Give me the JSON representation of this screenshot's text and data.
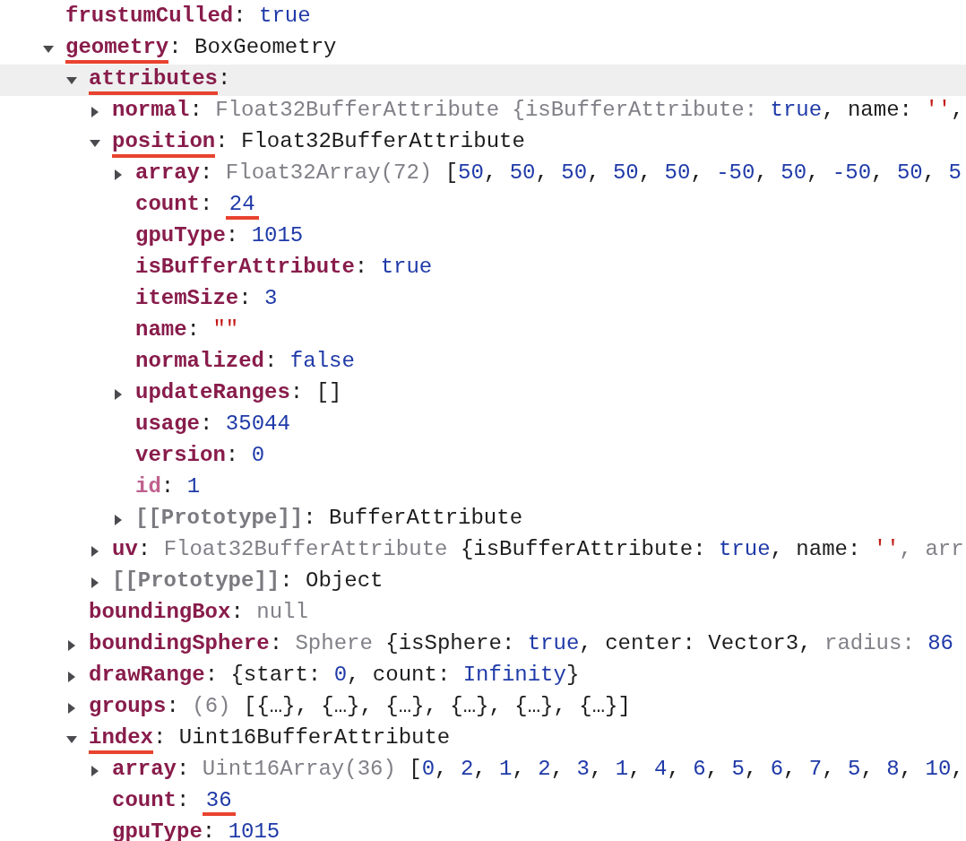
{
  "tree": [
    {
      "key": "frustumCulled",
      "kind": "normal",
      "selected": false,
      "key_underlined": false,
      "value": [
        {
          "text": ": ",
          "kind": "punct"
        },
        {
          "text": "true",
          "kind": "keyword"
        }
      ]
    },
    {
      "key": "geometry",
      "kind": "normal",
      "selected": false,
      "key_underlined": true,
      "expanded": true,
      "value": [
        {
          "text": ": BoxGeometry",
          "kind": "punct"
        }
      ],
      "children": [
        {
          "key": "attributes",
          "kind": "normal",
          "selected": true,
          "key_underlined": true,
          "expanded": true,
          "value": [
            {
              "text": ":",
              "kind": "punct"
            }
          ],
          "children": [
            {
              "key": "normal",
              "kind": "normal",
              "selected": false,
              "key_underlined": false,
              "expanded": false,
              "value": [
                {
                  "text": ": ",
                  "kind": "punct"
                },
                {
                  "text": "Float32BufferAttribute {isBufferAttribute: ",
                  "kind": "dim"
                },
                {
                  "text": "true",
                  "kind": "keyword"
                },
                {
                  "text": ", name: ",
                  "kind": "punct"
                },
                {
                  "text": "''",
                  "kind": "string"
                },
                {
                  "text": ",",
                  "kind": "punct"
                }
              ]
            },
            {
              "key": "position",
              "kind": "normal",
              "selected": false,
              "key_underlined": true,
              "expanded": true,
              "value": [
                {
                  "text": ": Float32BufferAttribute",
                  "kind": "punct"
                }
              ],
              "children": [
                {
                  "key": "array",
                  "kind": "normal",
                  "selected": false,
                  "key_underlined": false,
                  "expanded": false,
                  "value": [
                    {
                      "text": ": ",
                      "kind": "punct"
                    },
                    {
                      "text": "Float32Array(72) ",
                      "kind": "dim"
                    },
                    {
                      "text": "[",
                      "kind": "punct"
                    },
                    {
                      "text": "50",
                      "kind": "number"
                    },
                    {
                      "text": ", ",
                      "kind": "punct"
                    },
                    {
                      "text": "50",
                      "kind": "number"
                    },
                    {
                      "text": ", ",
                      "kind": "punct"
                    },
                    {
                      "text": "50",
                      "kind": "number"
                    },
                    {
                      "text": ", ",
                      "kind": "punct"
                    },
                    {
                      "text": "50",
                      "kind": "number"
                    },
                    {
                      "text": ", ",
                      "kind": "punct"
                    },
                    {
                      "text": "50",
                      "kind": "number"
                    },
                    {
                      "text": ", ",
                      "kind": "punct"
                    },
                    {
                      "text": "-50",
                      "kind": "number"
                    },
                    {
                      "text": ", ",
                      "kind": "punct"
                    },
                    {
                      "text": "50",
                      "kind": "number"
                    },
                    {
                      "text": ", ",
                      "kind": "punct"
                    },
                    {
                      "text": "-50",
                      "kind": "number"
                    },
                    {
                      "text": ", ",
                      "kind": "punct"
                    },
                    {
                      "text": "50",
                      "kind": "number"
                    },
                    {
                      "text": ", ",
                      "kind": "punct"
                    },
                    {
                      "text": "5",
                      "kind": "number"
                    }
                  ]
                },
                {
                  "key": "count",
                  "kind": "normal",
                  "selected": false,
                  "key_underlined": false,
                  "value_underlined": true,
                  "value": [
                    {
                      "text": ": ",
                      "kind": "punct"
                    },
                    {
                      "text": "24",
                      "kind": "number"
                    }
                  ]
                },
                {
                  "key": "gpuType",
                  "kind": "normal",
                  "selected": false,
                  "key_underlined": false,
                  "value": [
                    {
                      "text": ": ",
                      "kind": "punct"
                    },
                    {
                      "text": "1015",
                      "kind": "number"
                    }
                  ]
                },
                {
                  "key": "isBufferAttribute",
                  "kind": "normal",
                  "selected": false,
                  "key_underlined": false,
                  "value": [
                    {
                      "text": ": ",
                      "kind": "punct"
                    },
                    {
                      "text": "true",
                      "kind": "keyword"
                    }
                  ]
                },
                {
                  "key": "itemSize",
                  "kind": "normal",
                  "selected": false,
                  "key_underlined": false,
                  "value": [
                    {
                      "text": ": ",
                      "kind": "punct"
                    },
                    {
                      "text": "3",
                      "kind": "number"
                    }
                  ]
                },
                {
                  "key": "name",
                  "kind": "normal",
                  "selected": false,
                  "key_underlined": false,
                  "value": [
                    {
                      "text": ": ",
                      "kind": "punct"
                    },
                    {
                      "text": "\"\"",
                      "kind": "string"
                    }
                  ]
                },
                {
                  "key": "normalized",
                  "kind": "normal",
                  "selected": false,
                  "key_underlined": false,
                  "value": [
                    {
                      "text": ": ",
                      "kind": "punct"
                    },
                    {
                      "text": "false",
                      "kind": "keyword"
                    }
                  ]
                },
                {
                  "key": "updateRanges",
                  "kind": "normal",
                  "selected": false,
                  "key_underlined": false,
                  "expanded": false,
                  "value": [
                    {
                      "text": ": []",
                      "kind": "punct"
                    }
                  ]
                },
                {
                  "key": "usage",
                  "kind": "normal",
                  "selected": false,
                  "key_underlined": false,
                  "value": [
                    {
                      "text": ": ",
                      "kind": "punct"
                    },
                    {
                      "text": "35044",
                      "kind": "number"
                    }
                  ]
                },
                {
                  "key": "version",
                  "kind": "normal",
                  "selected": false,
                  "key_underlined": false,
                  "value": [
                    {
                      "text": ": ",
                      "kind": "punct"
                    },
                    {
                      "text": "0",
                      "kind": "number"
                    }
                  ]
                },
                {
                  "key": "id",
                  "kind": "private",
                  "selected": false,
                  "key_underlined": false,
                  "value": [
                    {
                      "text": ": ",
                      "kind": "punct"
                    },
                    {
                      "text": "1",
                      "kind": "number"
                    }
                  ]
                },
                {
                  "key": "[[Prototype]]",
                  "kind": "internal",
                  "selected": false,
                  "key_underlined": false,
                  "expanded": false,
                  "value": [
                    {
                      "text": ": BufferAttribute",
                      "kind": "punct"
                    }
                  ]
                }
              ]
            },
            {
              "key": "uv",
              "kind": "normal",
              "selected": false,
              "key_underlined": false,
              "expanded": false,
              "value": [
                {
                  "text": ": ",
                  "kind": "punct"
                },
                {
                  "text": "Float32BufferAttribute ",
                  "kind": "dim"
                },
                {
                  "text": "{isBufferAttribute: ",
                  "kind": "punct"
                },
                {
                  "text": "true",
                  "kind": "keyword"
                },
                {
                  "text": ", name: ",
                  "kind": "punct"
                },
                {
                  "text": "''",
                  "kind": "string"
                },
                {
                  "text": ", arr",
                  "kind": "dim"
                }
              ]
            },
            {
              "key": "[[Prototype]]",
              "kind": "internal",
              "selected": false,
              "key_underlined": false,
              "expanded": false,
              "value": [
                {
                  "text": ": Object",
                  "kind": "punct"
                }
              ]
            }
          ]
        },
        {
          "key": "boundingBox",
          "kind": "normal",
          "selected": false,
          "key_underlined": false,
          "value": [
            {
              "text": ": ",
              "kind": "punct"
            },
            {
              "text": "null",
              "kind": "dim"
            }
          ]
        },
        {
          "key": "boundingSphere",
          "kind": "normal",
          "selected": false,
          "key_underlined": false,
          "expanded": false,
          "value": [
            {
              "text": ": ",
              "kind": "punct"
            },
            {
              "text": "Sphere ",
              "kind": "dim"
            },
            {
              "text": "{isSphere: ",
              "kind": "punct"
            },
            {
              "text": "true",
              "kind": "keyword"
            },
            {
              "text": ", center: Vector3, ",
              "kind": "punct"
            },
            {
              "text": "radius: ",
              "kind": "dim"
            },
            {
              "text": "86",
              "kind": "number"
            }
          ]
        },
        {
          "key": "drawRange",
          "kind": "normal",
          "selected": false,
          "key_underlined": false,
          "expanded": false,
          "value": [
            {
              "text": ": {start: ",
              "kind": "punct"
            },
            {
              "text": "0",
              "kind": "number"
            },
            {
              "text": ", count: ",
              "kind": "punct"
            },
            {
              "text": "Infinity",
              "kind": "number"
            },
            {
              "text": "}",
              "kind": "punct"
            }
          ]
        },
        {
          "key": "groups",
          "kind": "normal",
          "selected": false,
          "key_underlined": false,
          "expanded": false,
          "value": [
            {
              "text": ": ",
              "kind": "punct"
            },
            {
              "text": "(6) ",
              "kind": "dim"
            },
            {
              "text": "[{…}, {…}, {…}, {…}, {…}, {…}]",
              "kind": "punct"
            }
          ]
        },
        {
          "key": "index",
          "kind": "normal",
          "selected": false,
          "key_underlined": true,
          "expanded": true,
          "value": [
            {
              "text": ": Uint16BufferAttribute",
              "kind": "punct"
            }
          ],
          "children": [
            {
              "key": "array",
              "kind": "normal",
              "selected": false,
              "key_underlined": false,
              "expanded": false,
              "value": [
                {
                  "text": ": ",
                  "kind": "punct"
                },
                {
                  "text": "Uint16Array(36) ",
                  "kind": "dim"
                },
                {
                  "text": "[",
                  "kind": "punct"
                },
                {
                  "text": "0",
                  "kind": "number"
                },
                {
                  "text": ", ",
                  "kind": "punct"
                },
                {
                  "text": "2",
                  "kind": "number"
                },
                {
                  "text": ", ",
                  "kind": "punct"
                },
                {
                  "text": "1",
                  "kind": "number"
                },
                {
                  "text": ", ",
                  "kind": "punct"
                },
                {
                  "text": "2",
                  "kind": "number"
                },
                {
                  "text": ", ",
                  "kind": "punct"
                },
                {
                  "text": "3",
                  "kind": "number"
                },
                {
                  "text": ", ",
                  "kind": "punct"
                },
                {
                  "text": "1",
                  "kind": "number"
                },
                {
                  "text": ", ",
                  "kind": "punct"
                },
                {
                  "text": "4",
                  "kind": "number"
                },
                {
                  "text": ", ",
                  "kind": "punct"
                },
                {
                  "text": "6",
                  "kind": "number"
                },
                {
                  "text": ", ",
                  "kind": "punct"
                },
                {
                  "text": "5",
                  "kind": "number"
                },
                {
                  "text": ", ",
                  "kind": "punct"
                },
                {
                  "text": "6",
                  "kind": "number"
                },
                {
                  "text": ", ",
                  "kind": "punct"
                },
                {
                  "text": "7",
                  "kind": "number"
                },
                {
                  "text": ", ",
                  "kind": "punct"
                },
                {
                  "text": "5",
                  "kind": "number"
                },
                {
                  "text": ", ",
                  "kind": "punct"
                },
                {
                  "text": "8",
                  "kind": "number"
                },
                {
                  "text": ", ",
                  "kind": "punct"
                },
                {
                  "text": "10",
                  "kind": "number"
                },
                {
                  "text": ",",
                  "kind": "punct"
                }
              ]
            },
            {
              "key": "count",
              "kind": "normal",
              "selected": false,
              "key_underlined": false,
              "value_underlined": true,
              "value": [
                {
                  "text": ": ",
                  "kind": "punct"
                },
                {
                  "text": "36",
                  "kind": "number"
                }
              ]
            },
            {
              "key": "gpuType",
              "kind": "normal",
              "selected": false,
              "key_underlined": false,
              "value": [
                {
                  "text": ": ",
                  "kind": "punct"
                },
                {
                  "text": "1015",
                  "kind": "number"
                }
              ]
            }
          ]
        }
      ]
    }
  ]
}
